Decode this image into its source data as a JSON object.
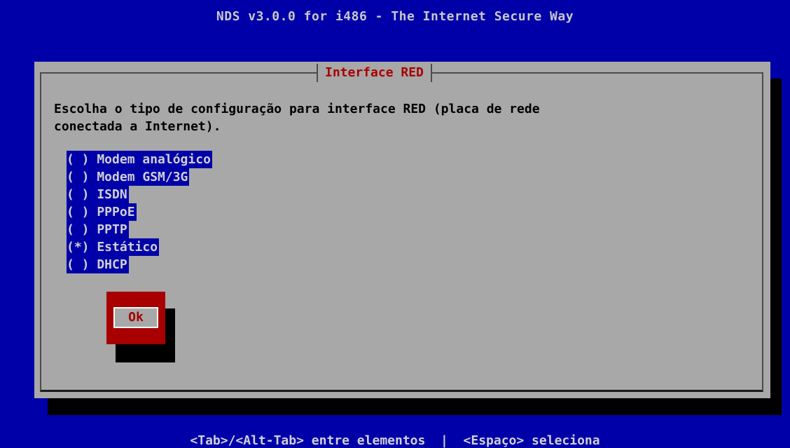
{
  "screen": {
    "title": "NDS v3.0.0 for i486 - The Internet Secure Way",
    "help": "<Tab>/<Alt-Tab> entre elementos  |  <Espaço> seleciona"
  },
  "dialog": {
    "title": "Interface RED",
    "prompt": "Escolha o tipo de configuração para interface RED (placa de rede\nconectada a Internet).",
    "options": [
      {
        "text": "( ) Modem analógico",
        "selected": false
      },
      {
        "text": "( ) Modem GSM/3G",
        "selected": false
      },
      {
        "text": "( ) ISDN",
        "selected": false
      },
      {
        "text": "( ) PPPoE",
        "selected": false
      },
      {
        "text": "( ) PPTP",
        "selected": false
      },
      {
        "text": "(*) Estático",
        "selected": true
      },
      {
        "text": "( ) DHCP",
        "selected": false
      }
    ],
    "ok_label": "Ok"
  },
  "colors": {
    "background": "#0000a8",
    "dialog": "#a8a8a8",
    "accent_red": "#a80000",
    "text_light": "#d0d0d8"
  }
}
